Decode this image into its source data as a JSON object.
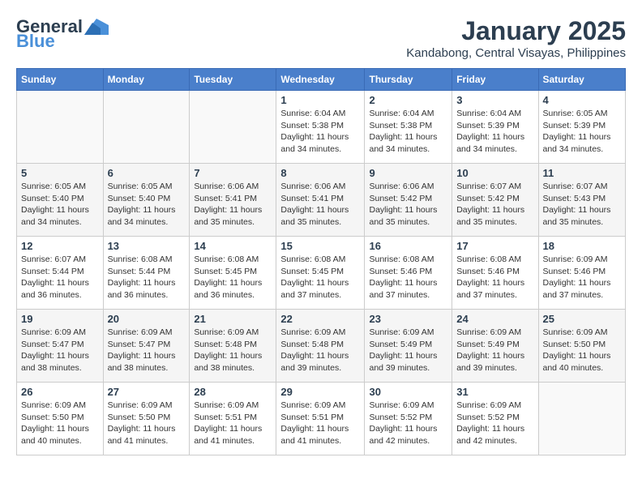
{
  "header": {
    "logo_general": "General",
    "logo_blue": "Blue",
    "month": "January 2025",
    "location": "Kandabong, Central Visayas, Philippines"
  },
  "days_of_week": [
    "Sunday",
    "Monday",
    "Tuesday",
    "Wednesday",
    "Thursday",
    "Friday",
    "Saturday"
  ],
  "weeks": [
    [
      {
        "day": "",
        "info": ""
      },
      {
        "day": "",
        "info": ""
      },
      {
        "day": "",
        "info": ""
      },
      {
        "day": "1",
        "info": "Sunrise: 6:04 AM\nSunset: 5:38 PM\nDaylight: 11 hours\nand 34 minutes."
      },
      {
        "day": "2",
        "info": "Sunrise: 6:04 AM\nSunset: 5:38 PM\nDaylight: 11 hours\nand 34 minutes."
      },
      {
        "day": "3",
        "info": "Sunrise: 6:04 AM\nSunset: 5:39 PM\nDaylight: 11 hours\nand 34 minutes."
      },
      {
        "day": "4",
        "info": "Sunrise: 6:05 AM\nSunset: 5:39 PM\nDaylight: 11 hours\nand 34 minutes."
      }
    ],
    [
      {
        "day": "5",
        "info": "Sunrise: 6:05 AM\nSunset: 5:40 PM\nDaylight: 11 hours\nand 34 minutes."
      },
      {
        "day": "6",
        "info": "Sunrise: 6:05 AM\nSunset: 5:40 PM\nDaylight: 11 hours\nand 34 minutes."
      },
      {
        "day": "7",
        "info": "Sunrise: 6:06 AM\nSunset: 5:41 PM\nDaylight: 11 hours\nand 35 minutes."
      },
      {
        "day": "8",
        "info": "Sunrise: 6:06 AM\nSunset: 5:41 PM\nDaylight: 11 hours\nand 35 minutes."
      },
      {
        "day": "9",
        "info": "Sunrise: 6:06 AM\nSunset: 5:42 PM\nDaylight: 11 hours\nand 35 minutes."
      },
      {
        "day": "10",
        "info": "Sunrise: 6:07 AM\nSunset: 5:42 PM\nDaylight: 11 hours\nand 35 minutes."
      },
      {
        "day": "11",
        "info": "Sunrise: 6:07 AM\nSunset: 5:43 PM\nDaylight: 11 hours\nand 35 minutes."
      }
    ],
    [
      {
        "day": "12",
        "info": "Sunrise: 6:07 AM\nSunset: 5:44 PM\nDaylight: 11 hours\nand 36 minutes."
      },
      {
        "day": "13",
        "info": "Sunrise: 6:08 AM\nSunset: 5:44 PM\nDaylight: 11 hours\nand 36 minutes."
      },
      {
        "day": "14",
        "info": "Sunrise: 6:08 AM\nSunset: 5:45 PM\nDaylight: 11 hours\nand 36 minutes."
      },
      {
        "day": "15",
        "info": "Sunrise: 6:08 AM\nSunset: 5:45 PM\nDaylight: 11 hours\nand 37 minutes."
      },
      {
        "day": "16",
        "info": "Sunrise: 6:08 AM\nSunset: 5:46 PM\nDaylight: 11 hours\nand 37 minutes."
      },
      {
        "day": "17",
        "info": "Sunrise: 6:08 AM\nSunset: 5:46 PM\nDaylight: 11 hours\nand 37 minutes."
      },
      {
        "day": "18",
        "info": "Sunrise: 6:09 AM\nSunset: 5:46 PM\nDaylight: 11 hours\nand 37 minutes."
      }
    ],
    [
      {
        "day": "19",
        "info": "Sunrise: 6:09 AM\nSunset: 5:47 PM\nDaylight: 11 hours\nand 38 minutes."
      },
      {
        "day": "20",
        "info": "Sunrise: 6:09 AM\nSunset: 5:47 PM\nDaylight: 11 hours\nand 38 minutes."
      },
      {
        "day": "21",
        "info": "Sunrise: 6:09 AM\nSunset: 5:48 PM\nDaylight: 11 hours\nand 38 minutes."
      },
      {
        "day": "22",
        "info": "Sunrise: 6:09 AM\nSunset: 5:48 PM\nDaylight: 11 hours\nand 39 minutes."
      },
      {
        "day": "23",
        "info": "Sunrise: 6:09 AM\nSunset: 5:49 PM\nDaylight: 11 hours\nand 39 minutes."
      },
      {
        "day": "24",
        "info": "Sunrise: 6:09 AM\nSunset: 5:49 PM\nDaylight: 11 hours\nand 39 minutes."
      },
      {
        "day": "25",
        "info": "Sunrise: 6:09 AM\nSunset: 5:50 PM\nDaylight: 11 hours\nand 40 minutes."
      }
    ],
    [
      {
        "day": "26",
        "info": "Sunrise: 6:09 AM\nSunset: 5:50 PM\nDaylight: 11 hours\nand 40 minutes."
      },
      {
        "day": "27",
        "info": "Sunrise: 6:09 AM\nSunset: 5:50 PM\nDaylight: 11 hours\nand 41 minutes."
      },
      {
        "day": "28",
        "info": "Sunrise: 6:09 AM\nSunset: 5:51 PM\nDaylight: 11 hours\nand 41 minutes."
      },
      {
        "day": "29",
        "info": "Sunrise: 6:09 AM\nSunset: 5:51 PM\nDaylight: 11 hours\nand 41 minutes."
      },
      {
        "day": "30",
        "info": "Sunrise: 6:09 AM\nSunset: 5:52 PM\nDaylight: 11 hours\nand 42 minutes."
      },
      {
        "day": "31",
        "info": "Sunrise: 6:09 AM\nSunset: 5:52 PM\nDaylight: 11 hours\nand 42 minutes."
      },
      {
        "day": "",
        "info": ""
      }
    ]
  ]
}
